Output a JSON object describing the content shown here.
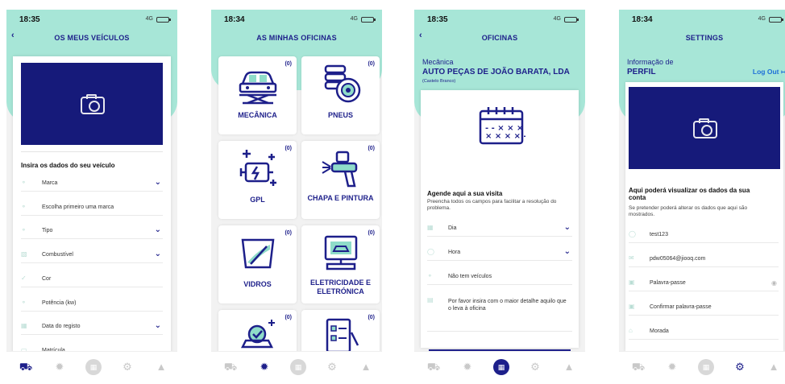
{
  "screens": [
    {
      "time": "18:35",
      "network": "4G",
      "title": "OS MEUS VEÍCULOS",
      "back": "‹",
      "section_title": "Insira os dados do seu veículo",
      "fields": [
        {
          "label": "Marca",
          "icon": "car-icon",
          "dropdown": true
        },
        {
          "label": "Escolha primeiro uma marca",
          "icon": "car-icon",
          "dropdown": false
        },
        {
          "label": "Tipo",
          "icon": "car-icon",
          "dropdown": true
        },
        {
          "label": "Combustível",
          "icon": "fuel-icon",
          "dropdown": true
        },
        {
          "label": "Cor",
          "icon": "brush-icon",
          "dropdown": false
        },
        {
          "label": "Potência (kw)",
          "icon": "car-icon",
          "dropdown": false
        },
        {
          "label": "Data do registo",
          "icon": "calendar-icon",
          "dropdown": true
        },
        {
          "label": "Matrícula",
          "icon": "plate-icon",
          "dropdown": false
        }
      ]
    },
    {
      "time": "18:34",
      "network": "4G",
      "title": "AS MINHAS OFICINAS",
      "tiles": [
        {
          "name": "MECÂNICA",
          "count": "(0)"
        },
        {
          "name": "PNEUS",
          "count": "(0)"
        },
        {
          "name": "GPL",
          "count": "(0)"
        },
        {
          "name": "CHAPA E PINTURA",
          "count": "(0)"
        },
        {
          "name": "VIDROS",
          "count": "(0)"
        },
        {
          "name": "ELETRICIDADE E ELETRÓNICA",
          "count": "(0)"
        },
        {
          "name": "",
          "count": "(0)"
        },
        {
          "name": "",
          "count": "(0)"
        }
      ]
    },
    {
      "time": "18:35",
      "network": "4G",
      "title": "OFICINAS",
      "back": "‹",
      "category": "Mecânica",
      "company": "AUTO PEÇAS DE JOÃO BARATA, LDA",
      "location": "(Castelo Branco)",
      "section_title": "Agende aqui a sua visita",
      "section_sub": "Preencha todos os campos para facilitar a resolução do problema.",
      "fields": [
        {
          "label": "Dia",
          "icon": "calendar-icon",
          "dropdown": true
        },
        {
          "label": "Hora",
          "icon": "clock-icon",
          "dropdown": true
        },
        {
          "label": "Não tem veículos",
          "icon": "car-icon",
          "dropdown": false
        },
        {
          "label": "Por favor insira com o maior detalhe aquilo que o leva à oficina",
          "icon": "message-icon",
          "dropdown": false
        }
      ]
    },
    {
      "time": "18:34",
      "network": "4G",
      "title": "SETTINGS",
      "section_label": "Informação de",
      "perfil": "PERFIL",
      "logout": "Log Out",
      "section_title": "Aqui poderá visualizar os dados da sua conta",
      "section_sub": "Se pretender poderá alterar os dados que aqui são mostrados.",
      "fields": [
        {
          "label": "test123",
          "icon": "user-icon"
        },
        {
          "label": "pdw05064@jiooq.com",
          "icon": "mail-icon"
        },
        {
          "label": "Palavra-passe",
          "icon": "lock-icon",
          "eye": true
        },
        {
          "label": "Confirmar palavra-passe",
          "icon": "lock-icon"
        },
        {
          "label": "Morada",
          "icon": "home-icon"
        }
      ]
    }
  ],
  "tabbar_icons": [
    "car-tab-icon",
    "tire-tab-icon",
    "workshop-tab-icon",
    "settings-tab-icon",
    "bell-tab-icon"
  ],
  "colors": {
    "teal": "#a7e6d7",
    "navy": "#1d1f8a",
    "camera_bg": "#161a7a",
    "link_blue": "#1d6fd8"
  }
}
